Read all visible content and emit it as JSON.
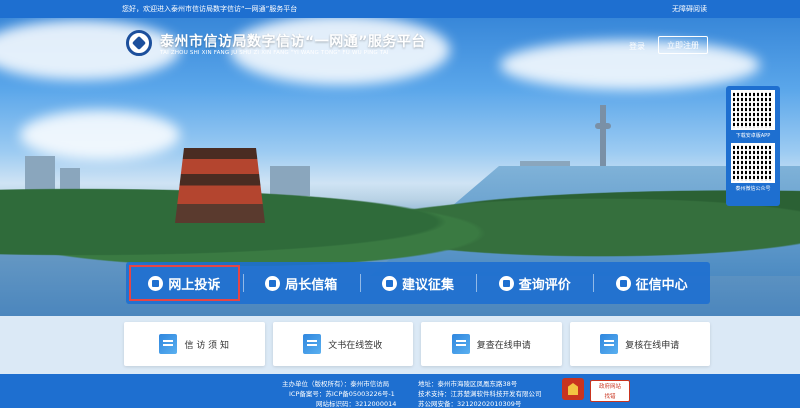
{
  "topbar": {
    "welcome": "您好，欢迎进入泰州市信访局数字信访“一网通”服务平台",
    "accessibility": "无障碍阅读"
  },
  "header": {
    "title": "泰州市信访局数字信访“一网通”服务平台",
    "subtitle": "TAI ZHOU SHI XIN FANG JU SHU ZI XIN FANG \"YI WANG TONG\" FU WU PING TAI",
    "login": "登录",
    "register": "立即注册"
  },
  "qr": {
    "app_label": "下载安卓版APP",
    "wechat_label": "泰州微信公众号"
  },
  "nav": {
    "items": [
      {
        "label": "网上投诉",
        "icon": "complaint-icon",
        "selected": true
      },
      {
        "label": "局长信箱",
        "icon": "mailbox-icon",
        "selected": false
      },
      {
        "label": "建议征集",
        "icon": "suggestion-icon",
        "selected": false
      },
      {
        "label": "查询评价",
        "icon": "search-evaluate-icon",
        "selected": false
      },
      {
        "label": "征信中心",
        "icon": "credit-center-icon",
        "selected": false
      }
    ]
  },
  "cards": [
    {
      "label": "信 访 须 知",
      "icon": "notice-icon"
    },
    {
      "label": "文书在线签收",
      "icon": "document-sign-icon"
    },
    {
      "label": "复查在线申请",
      "icon": "review-apply-icon"
    },
    {
      "label": "复核在线申请",
      "icon": "recheck-apply-icon"
    }
  ],
  "footer": {
    "host": "主办单位（版权所有）：泰州市信访局",
    "icp": "ICP备案号：苏ICP备05003226号-1",
    "site_id": "网站标识码：3212000014",
    "address": "地址：泰州市海陵区凤凰东路38号",
    "support": "技术支持：江苏楚渊软件科技开发有限公司",
    "police": "苏公网安备：32120202010309号",
    "badge2_line1": "政府网站",
    "badge2_line2": "找错"
  },
  "colors": {
    "primary": "#1e6fd0",
    "selected_outline": "#e64545"
  }
}
